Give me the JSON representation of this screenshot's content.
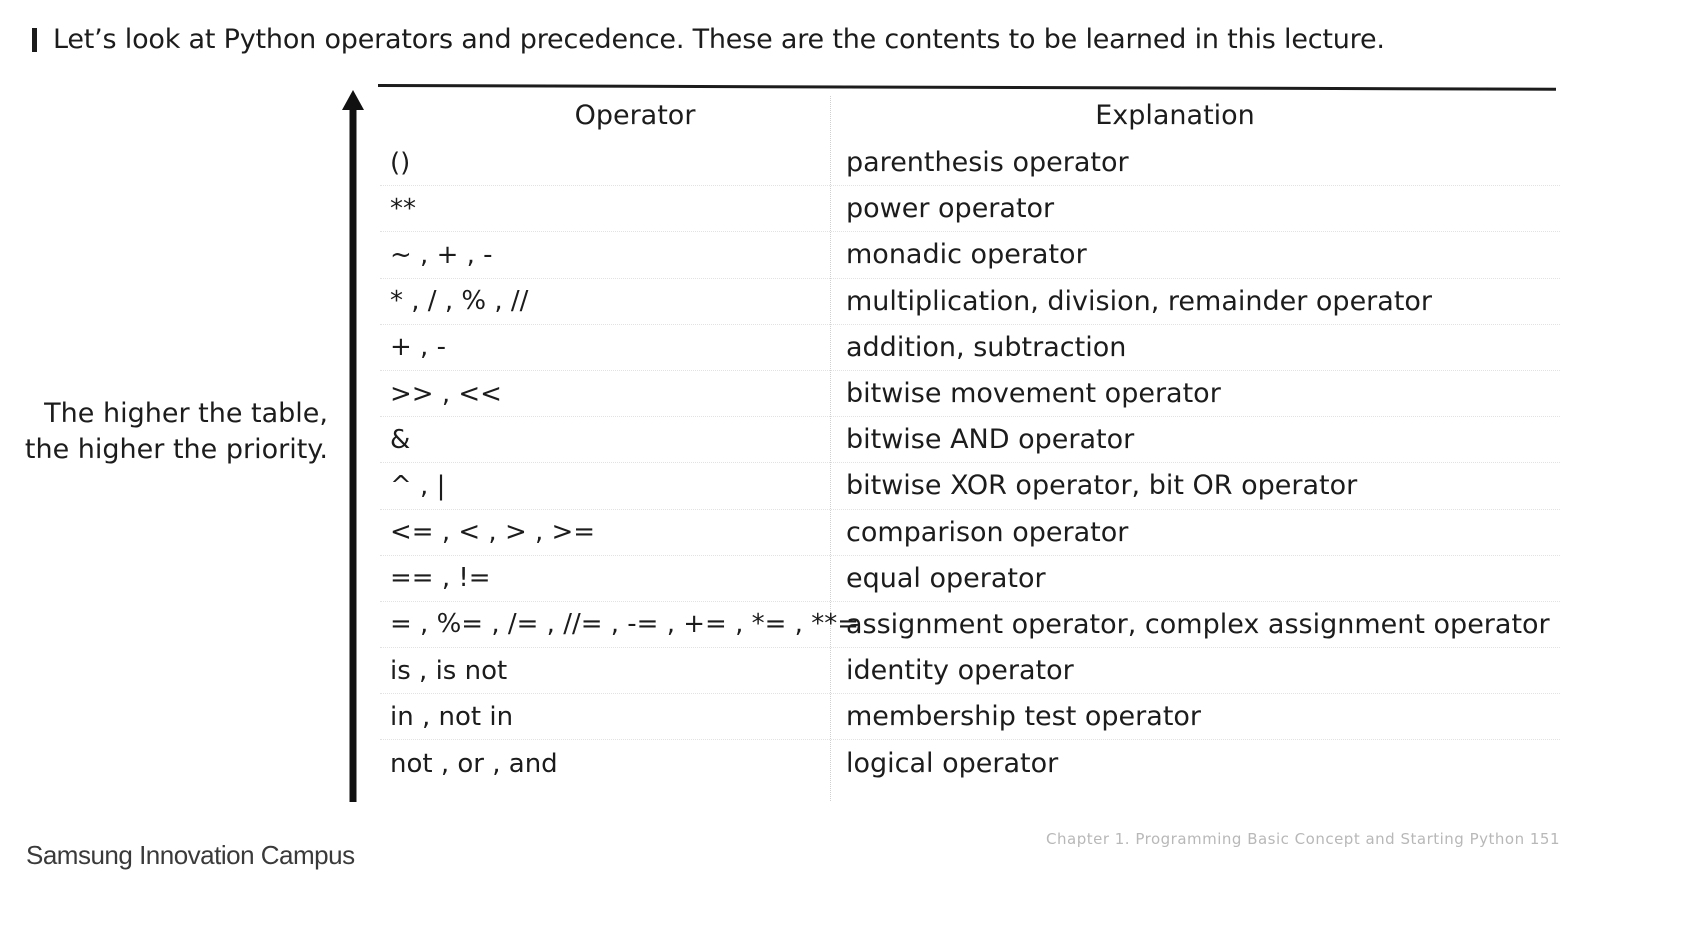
{
  "intro": "Let’s look at Python operators and precedence. These are the contents to be learned in this lecture.",
  "side_note": {
    "line1": "The higher the table,",
    "line2": "the higher the priority."
  },
  "table": {
    "headers": {
      "operator": "Operator",
      "explanation": "Explanation"
    },
    "rows": [
      {
        "operator": "()",
        "explanation": "parenthesis operator"
      },
      {
        "operator": "**",
        "explanation": "power operator"
      },
      {
        "operator": "~ , + , -",
        "explanation": "monadic operator"
      },
      {
        "operator": "* , / , % , //",
        "explanation": "multiplication, division, remainder operator"
      },
      {
        "operator": "+ , -",
        "explanation": "addition, subtraction"
      },
      {
        "operator": ">> , <<",
        "explanation": "bitwise movement operator"
      },
      {
        "operator": "&",
        "explanation": "bitwise AND operator"
      },
      {
        "operator": "^ , |",
        "explanation": "bitwise XOR operator, bit OR operator"
      },
      {
        "operator": "<= , < , > , >=",
        "explanation": "comparison operator"
      },
      {
        "operator": "== , !=",
        "explanation": "equal operator"
      },
      {
        "operator": "= , %= , /= , //= , -= , += , *= , **=",
        "explanation": "assignment operator, complex assignment operator"
      },
      {
        "operator": "is , is not",
        "explanation": "identity operator"
      },
      {
        "operator": "in , not in",
        "explanation": "membership test operator"
      },
      {
        "operator": "not , or , and",
        "explanation": "logical operator"
      }
    ]
  },
  "footer": {
    "brand": "Samsung Innovation Campus",
    "chapter": "Chapter 1. Programming Basic Concept and Starting Python",
    "page": "151"
  }
}
